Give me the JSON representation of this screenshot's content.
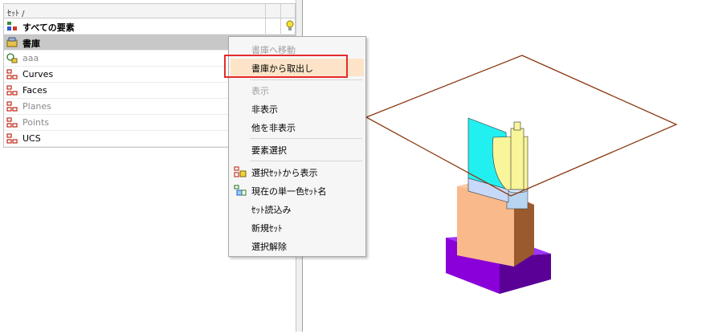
{
  "set_panel": {
    "header": "ｾｯﾄ /",
    "rows": [
      {
        "label": "すべての要素",
        "icon": "all-elements-icon"
      },
      {
        "label": "書庫",
        "icon": "library-icon"
      },
      {
        "label": "aaa",
        "icon": "set-icon"
      },
      {
        "label": "Curves",
        "icon": "set-tree-icon"
      },
      {
        "label": "Faces",
        "icon": "set-tree-icon"
      },
      {
        "label": "Planes",
        "icon": "set-tree-icon"
      },
      {
        "label": "Points",
        "icon": "set-tree-icon"
      },
      {
        "label": "UCS",
        "icon": "set-tree-icon"
      }
    ],
    "bulb_icon": "lightbulb-icon"
  },
  "context_menu": {
    "items": [
      {
        "label": "書庫へ移動",
        "state": "disabled"
      },
      {
        "label": "書庫から取出し",
        "state": "highlighted"
      },
      {
        "label": "表示",
        "state": "disabled"
      },
      {
        "label": "非表示",
        "state": "normal"
      },
      {
        "label": "他を非表示",
        "state": "normal"
      },
      {
        "label": "要素選択",
        "state": "normal"
      },
      {
        "label": "選択ｾｯﾄから表示",
        "state": "normal",
        "icon": "show-from-set-icon"
      },
      {
        "label": "現在の単一色ｾｯﾄ名",
        "state": "normal",
        "icon": "color-set-icon"
      },
      {
        "label": "ｾｯﾄ読込み",
        "state": "normal"
      },
      {
        "label": "新規ｾｯﾄ",
        "state": "normal"
      },
      {
        "label": "選択解除",
        "state": "normal"
      }
    ]
  },
  "colors": {
    "highlight_border": "#e52b2b",
    "menu_highlight": "#fde4c8",
    "plane_outline": "#8b3a12",
    "block_bottom": "#8a00d8",
    "block_middle": "#f9b98a",
    "part_cyan": "#22f0f0",
    "part_yellow": "#f8f59a"
  }
}
